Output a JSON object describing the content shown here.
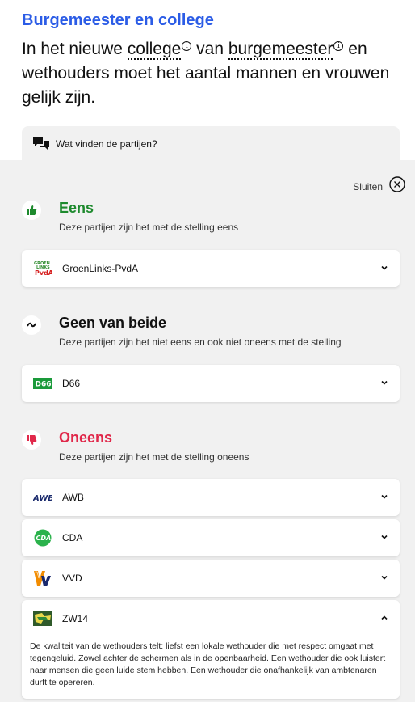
{
  "header": {
    "topic": "Burgemeester en college",
    "statement_part1": "In het nieuwe ",
    "term1": "college",
    "statement_part2": " van ",
    "term2": "burgemeester",
    "statement_part3": " en wethouders moet het aantal mannen en vrouwen gelijk zijn.",
    "info_glyph": "i"
  },
  "tab": {
    "label": "Wat vinden de partijen?",
    "icon": "speech-bubbles-icon"
  },
  "close": {
    "label": "Sluiten",
    "icon": "close-circle-icon"
  },
  "groups": {
    "eens": {
      "title": "Eens",
      "subtitle": "Deze partijen zijn het met de stelling eens",
      "icon": "thumbs-up-icon",
      "color": "#1e8a2e",
      "parties": [
        {
          "name": "GroenLinks-PvdA",
          "logo_text": "GROEN LINKS PvdA"
        }
      ]
    },
    "neutraal": {
      "title": "Geen van beide",
      "subtitle": "Deze partijen zijn het niet eens en ook niet oneens met de stelling",
      "icon": "tilde-icon",
      "parties": [
        {
          "name": "D66",
          "logo_text": "D66"
        }
      ]
    },
    "oneens": {
      "title": "Oneens",
      "subtitle": "Deze partijen zijn het met de stelling oneens",
      "icon": "thumbs-down-icon",
      "color": "#e0284a",
      "parties": [
        {
          "name": "AWB",
          "logo_text": "AWB"
        },
        {
          "name": "CDA",
          "logo_text": "CDA"
        },
        {
          "name": "VVD",
          "logo_text": "VVD"
        },
        {
          "name": "ZW14",
          "expanded": true,
          "explanation": "De kwaliteit van de wethouders telt: liefst een lokale wethouder die met respect omgaat met tegengeluid. Zowel achter de schermen als in de openbaarheid. Een wethouder die ook luistert naar mensen die geen luide stem hebben. Een wethouder die onafhankelijk van ambtenaren durft te opereren."
        }
      ]
    }
  }
}
